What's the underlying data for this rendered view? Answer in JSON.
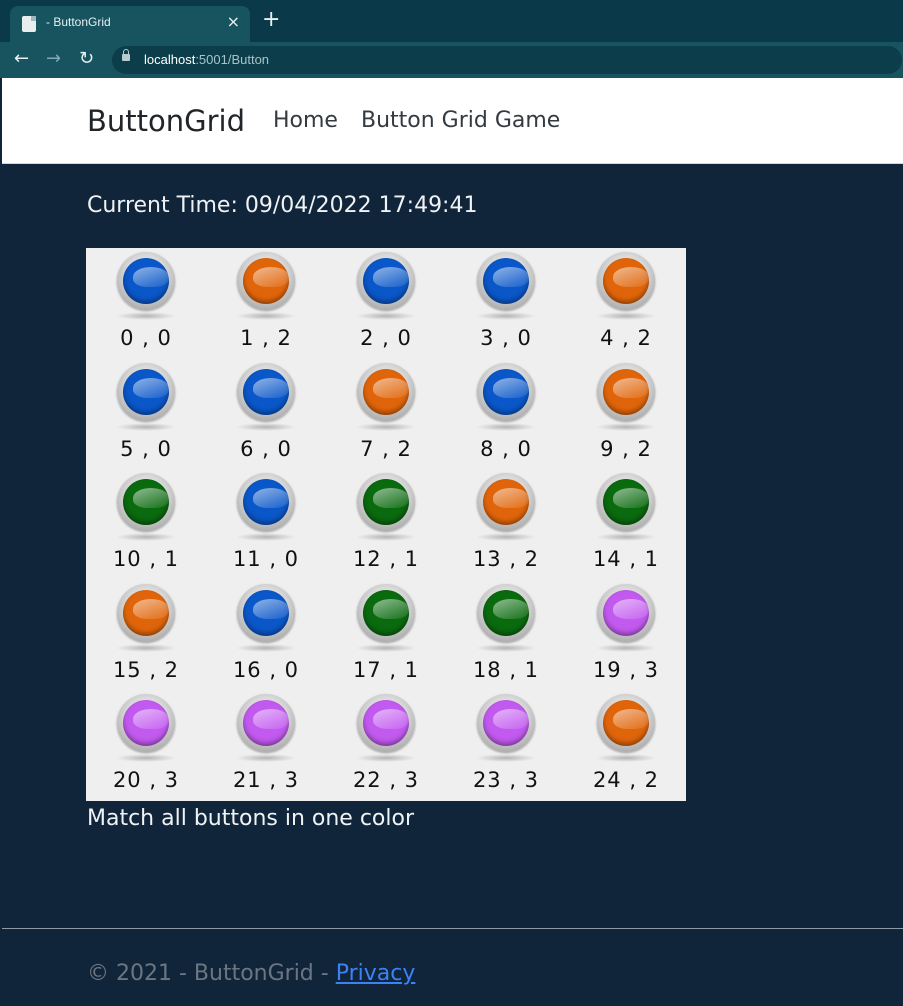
{
  "browser": {
    "tab_title": "- ButtonGrid",
    "tab_close": "×",
    "new_tab": "+",
    "url_host": "localhost",
    "url_path": ":5001/Button",
    "back": "←",
    "forward": "→",
    "reload": "↻"
  },
  "navbar": {
    "brand": "ButtonGrid",
    "links": [
      "Home",
      "Button Grid Game"
    ]
  },
  "main": {
    "current_time": "Current Time: 09/04/2022 17:49:41",
    "hint": "Match all buttons in one color"
  },
  "colors": {
    "0": "#0a57c9",
    "1": "#0a6a0e",
    "2": "#e0650a",
    "3": "#c25af0"
  },
  "grid": {
    "columns": 5,
    "cells": [
      {
        "label": "0 , 0",
        "state": 0
      },
      {
        "label": "1 , 2",
        "state": 2
      },
      {
        "label": "2 , 0",
        "state": 0
      },
      {
        "label": "3 , 0",
        "state": 0
      },
      {
        "label": "4 , 2",
        "state": 2
      },
      {
        "label": "5 , 0",
        "state": 0
      },
      {
        "label": "6 , 0",
        "state": 0
      },
      {
        "label": "7 , 2",
        "state": 2
      },
      {
        "label": "8 , 0",
        "state": 0
      },
      {
        "label": "9 , 2",
        "state": 2
      },
      {
        "label": "10 , 1",
        "state": 1
      },
      {
        "label": "11 , 0",
        "state": 0
      },
      {
        "label": "12 , 1",
        "state": 1
      },
      {
        "label": "13 , 2",
        "state": 2
      },
      {
        "label": "14 , 1",
        "state": 1
      },
      {
        "label": "15 , 2",
        "state": 2
      },
      {
        "label": "16 , 0",
        "state": 0
      },
      {
        "label": "17 , 1",
        "state": 1
      },
      {
        "label": "18 , 1",
        "state": 1
      },
      {
        "label": "19 , 3",
        "state": 3
      },
      {
        "label": "20 , 3",
        "state": 3
      },
      {
        "label": "21 , 3",
        "state": 3
      },
      {
        "label": "22 , 3",
        "state": 3
      },
      {
        "label": "23 , 3",
        "state": 3
      },
      {
        "label": "24 , 2",
        "state": 2
      }
    ]
  },
  "footer": {
    "text": "© 2021 - ButtonGrid - ",
    "privacy": "Privacy"
  }
}
